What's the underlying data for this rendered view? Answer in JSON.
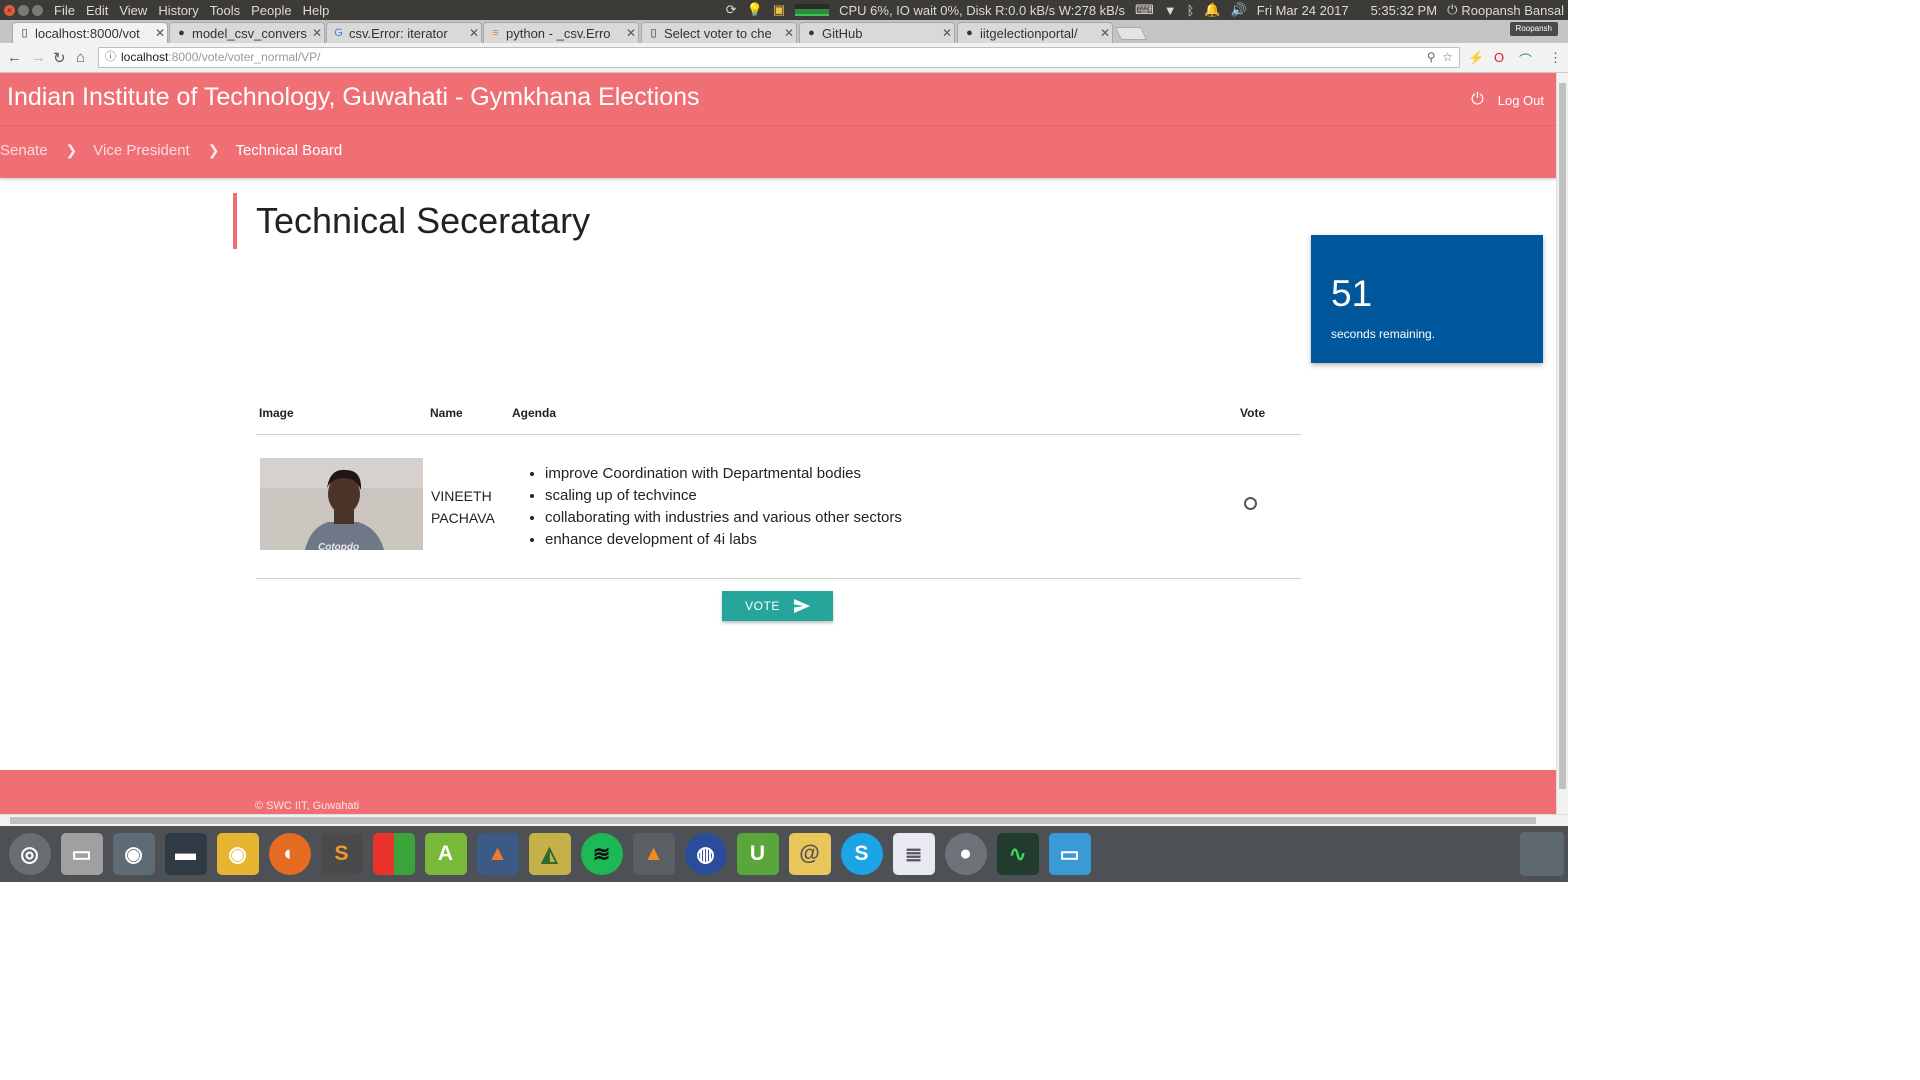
{
  "os": {
    "menu": [
      "File",
      "Edit",
      "View",
      "History",
      "Tools",
      "People",
      "Help"
    ],
    "status": "CPU 6%, IO wait 0%, Disk R:0.0 kB/s W:278 kB/s",
    "date": "Fri Mar 24 2017",
    "time": "5:35:32 PM",
    "user": "Roopansh Bansal"
  },
  "browser": {
    "tabs": [
      {
        "title": "localhost:8000/vot",
        "icon": "page-icon"
      },
      {
        "title": "model_csv_convers",
        "icon": "github-icon"
      },
      {
        "title": "csv.Error: iterator",
        "icon": "google-icon"
      },
      {
        "title": "python - _csv.Erro",
        "icon": "stackoverflow-icon"
      },
      {
        "title": "Select voter to che",
        "icon": "page-icon"
      },
      {
        "title": "GitHub",
        "icon": "github-icon"
      },
      {
        "title": "iitgelectionportal/",
        "icon": "github-icon"
      }
    ],
    "profile": "Roopansh",
    "url_host": "localhost",
    "url_path": ":8000/vote/voter_normal/VP/"
  },
  "site": {
    "title": "Indian Institute of Technology, Guwahati - Gymkhana Elections",
    "logout": "Log Out",
    "breadcrumbs": [
      "Senate",
      "Vice President",
      "Technical Board"
    ],
    "section_title": "Technical Seceratary",
    "timer": {
      "value": "51",
      "label": "seconds remaining."
    },
    "table": {
      "headers": {
        "image": "Image",
        "name": "Name",
        "agenda": "Agenda",
        "vote": "Vote"
      },
      "candidate": {
        "name_first": "VINEETH",
        "name_last": "PACHAVA",
        "agenda": [
          "improve Coordination with Departmental bodies",
          "scaling up of techvince",
          "collaborating with industries and various other sectors",
          "enhance development of 4i labs"
        ],
        "selected": false
      }
    },
    "vote_button": "VOTE",
    "footer": "© SWC IIT, Guwahati",
    "colors": {
      "header": "#f06f75",
      "timer": "#01579b",
      "button": "#26a69a"
    }
  },
  "dock": {
    "apps": [
      "ubuntu-dash-icon",
      "files-icon",
      "screenshot-icon",
      "terminal-icon",
      "chrome-icon",
      "firefox-icon",
      "sublime-icon",
      "libreoffice-impress-icon",
      "android-studio-icon",
      "matlab-icon",
      "wings-icon",
      "spotify-icon",
      "vlc-icon",
      "gimp-icon",
      "unetbootin-icon",
      "thunderbird-icon",
      "skype-icon",
      "text-editor-icon",
      "settings-icon",
      "system-monitor-icon",
      "workspaces-icon"
    ]
  }
}
